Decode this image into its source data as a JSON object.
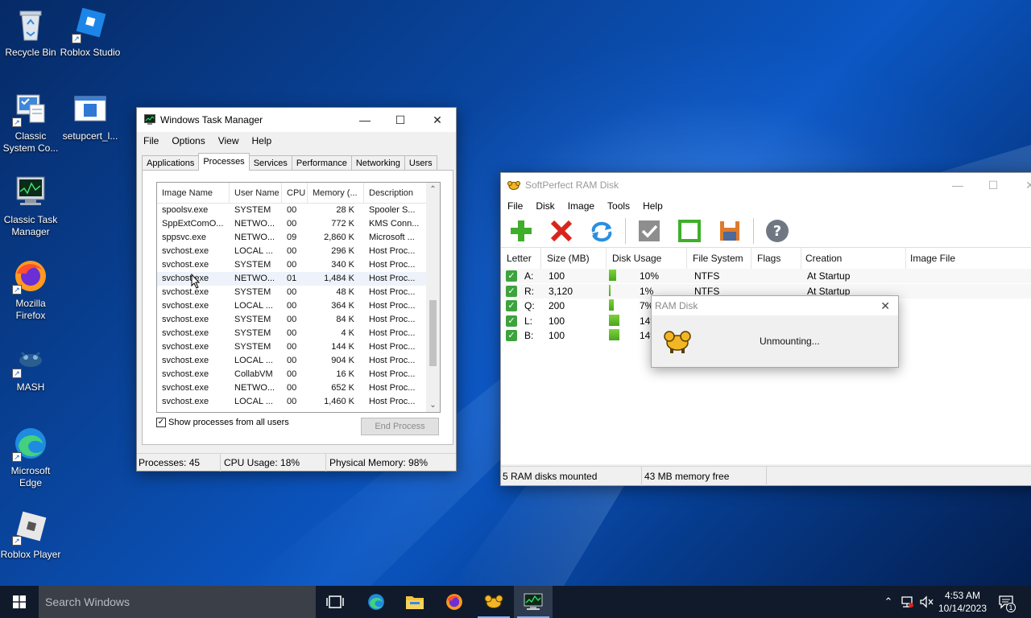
{
  "desktop": {
    "icons": [
      {
        "label": "Recycle Bin"
      },
      {
        "label": "Roblox Studio"
      },
      {
        "label": "Classic System Co..."
      },
      {
        "label": "setupcert_l..."
      },
      {
        "label": "Classic Task Manager"
      },
      {
        "label": "Mozilla Firefox"
      },
      {
        "label": "MASH"
      },
      {
        "label": "Microsoft Edge"
      },
      {
        "label": "Roblox Player"
      }
    ]
  },
  "taskmgr": {
    "title": "Windows Task Manager",
    "menu": [
      "File",
      "Options",
      "View",
      "Help"
    ],
    "tabs": [
      "Applications",
      "Processes",
      "Services",
      "Performance",
      "Networking",
      "Users"
    ],
    "active_tab": "Processes",
    "columns": [
      "Image Name",
      "User Name",
      "CPU",
      "Memory (...",
      "Description"
    ],
    "rows": [
      [
        "spoolsv.exe",
        "SYSTEM",
        "00",
        "28 K",
        "Spooler S..."
      ],
      [
        "SppExtComO...",
        "NETWO...",
        "00",
        "772 K",
        "KMS Conn..."
      ],
      [
        "sppsvc.exe",
        "NETWO...",
        "09",
        "2,860 K",
        "Microsoft ..."
      ],
      [
        "svchost.exe",
        "LOCAL ...",
        "00",
        "296 K",
        "Host Proc..."
      ],
      [
        "svchost.exe",
        "SYSTEM",
        "00",
        "340 K",
        "Host Proc..."
      ],
      [
        "svchost.exe",
        "NETWO...",
        "01",
        "1,484 K",
        "Host Proc..."
      ],
      [
        "svchost.exe",
        "SYSTEM",
        "00",
        "48 K",
        "Host Proc..."
      ],
      [
        "svchost.exe",
        "LOCAL ...",
        "00",
        "364 K",
        "Host Proc..."
      ],
      [
        "svchost.exe",
        "SYSTEM",
        "00",
        "84 K",
        "Host Proc..."
      ],
      [
        "svchost.exe",
        "SYSTEM",
        "00",
        "4 K",
        "Host Proc..."
      ],
      [
        "svchost.exe",
        "SYSTEM",
        "00",
        "144 K",
        "Host Proc..."
      ],
      [
        "svchost.exe",
        "LOCAL ...",
        "00",
        "904 K",
        "Host Proc..."
      ],
      [
        "svchost.exe",
        "CollabVM",
        "00",
        "16 K",
        "Host Proc..."
      ],
      [
        "svchost.exe",
        "NETWO...",
        "00",
        "652 K",
        "Host Proc..."
      ],
      [
        "svchost.exe",
        "LOCAL ...",
        "00",
        "1,460 K",
        "Host Proc..."
      ]
    ],
    "show_all_label": "Show processes from all users",
    "show_all_checked": true,
    "end_process_label": "End Process",
    "status": {
      "processes": "Processes: 45",
      "cpu": "CPU Usage: 18%",
      "memory": "Physical Memory: 98%"
    }
  },
  "ramdisk": {
    "title": "SoftPerfect RAM Disk",
    "menu": [
      "File",
      "Disk",
      "Image",
      "Tools",
      "Help"
    ],
    "toolbar": [
      "add-icon",
      "remove-icon",
      "refresh-icon",
      "check-icon",
      "square-icon",
      "save-icon",
      "help-icon"
    ],
    "columns": [
      "Letter",
      "Size (MB)",
      "Disk Usage",
      "File System",
      "Flags",
      "Creation",
      "Image File"
    ],
    "disks": [
      {
        "letter": "A:",
        "size": "100",
        "usage_label": "10%",
        "usage": 10,
        "fs": "NTFS",
        "creation": "At Startup"
      },
      {
        "letter": "R:",
        "size": "3,120",
        "usage_label": "1%",
        "usage": 1,
        "fs": "NTFS",
        "creation": "At Startup"
      },
      {
        "letter": "Q:",
        "size": "200",
        "usage_label": "7%",
        "usage": 7,
        "fs": "",
        "creation": ""
      },
      {
        "letter": "L:",
        "size": "100",
        "usage_label": "14%",
        "usage": 14,
        "fs": "",
        "creation": ""
      },
      {
        "letter": "B:",
        "size": "100",
        "usage_label": "14%",
        "usage": 14,
        "fs": "",
        "creation": ""
      }
    ],
    "status": {
      "mounted": "5 RAM disks mounted",
      "free": "43 MB memory free"
    }
  },
  "dialog": {
    "title": "RAM Disk",
    "message": "Unmounting..."
  },
  "taskbar": {
    "search_placeholder": "Search Windows",
    "time": "4:53 AM",
    "date": "10/14/2023",
    "notification_count": "1"
  },
  "colors": {
    "accent": "#0b57c4",
    "taskbar": "#101a2a",
    "green_check": "#3da33d"
  }
}
